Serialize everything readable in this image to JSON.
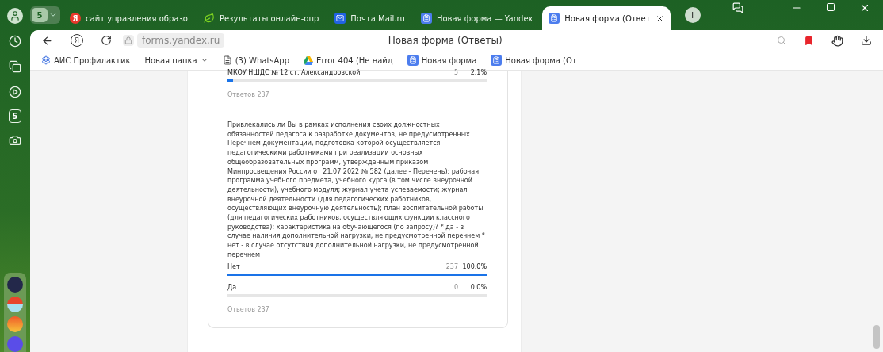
{
  "tab_group": {
    "label": "5"
  },
  "tabs": [
    {
      "kind": "yandex",
      "badge": "Я",
      "title": "сайт управления образо",
      "selected": false
    },
    {
      "kind": "leaf",
      "title": "Результаты онлайн-опр",
      "selected": false
    },
    {
      "kind": "mail",
      "title": "Почта Mail.ru",
      "selected": false
    },
    {
      "kind": "form",
      "title": "Новая форма — Yandex",
      "selected": false
    },
    {
      "kind": "form",
      "title": "Новая форма (Ответ",
      "selected": true
    }
  ],
  "profile_letter": "I",
  "toolbar": {
    "home_letter": "Я",
    "address": "forms.yandex.ru",
    "page_title": "Новая форма (Ответы)",
    "bookmarked": true
  },
  "bookmarks": [
    {
      "kind": "gear",
      "title": "АИС Профилактик"
    },
    {
      "kind": "folder",
      "title": "Новая папка"
    },
    {
      "kind": "page",
      "title": "(3) WhatsApp"
    },
    {
      "kind": "drive",
      "title": "Error 404 (Не найд"
    },
    {
      "kind": "form",
      "title": "Новая форма"
    },
    {
      "kind": "form",
      "title": "Новая форма (От"
    }
  ],
  "sidebar": [
    {
      "kind": "clock"
    },
    {
      "kind": "tabs"
    },
    {
      "kind": "play"
    },
    {
      "kind": "badge",
      "label": "5"
    },
    {
      "kind": "camera"
    }
  ],
  "dock": [
    {
      "kind": "dark"
    },
    {
      "kind": "umbrella"
    },
    {
      "kind": "mail"
    },
    {
      "kind": "purple"
    }
  ],
  "results_top": {
    "options": [
      {
        "label": "МКОУ НШДС № 12 ст. Александровской",
        "count": "5",
        "percent": "2.1%",
        "level": 0.021
      }
    ],
    "answers": "Ответов 237"
  },
  "question": {
    "text": "Привлекались ли Вы в рамках исполнения своих должностных обязанностей педагога к разработке документов, не предусмотренных Перечнем документации, подготовка которой осуществляется педагогическими работниками при реализации основных общеобразовательных программ, утвержденным приказом Минпросвещения России от 21.07.2022 № 582 (далее - Перечень): рабочая программа учебного предмета, учебного курса (в том числе внеурочной деятельности), учебного модуля; журнал учета успеваемости; журнал внеурочной деятельности (для педагогических работников, осуществляющих внеурочную деятельность); план воспитательной работы (для педагогических работников, осуществляющих функции классного руководства); характеристика на обучающегося (по запросу)? * да - в случае наличия дополнительной нагрузки, не предусмотренной перечнем * нет - в случае отсутствия дополнительной нагрузки, не предусмотренной перечнем",
    "options": [
      {
        "label": "Нет",
        "count": "237",
        "percent": "100.0%",
        "level": 1
      },
      {
        "label": "Да",
        "count": "0",
        "percent": "0.0%",
        "level": 0
      }
    ],
    "answers": "Ответов 237"
  }
}
